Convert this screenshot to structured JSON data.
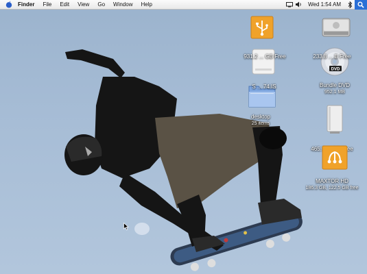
{
  "menubar": {
    "apple_icon": "apple-icon",
    "app_name": "Finder",
    "menus": [
      "File",
      "Edit",
      "View",
      "Go",
      "Window",
      "Help"
    ],
    "clock": "Wed 1:54 AM"
  },
  "desktop": {
    "icons": [
      {
        "label": "",
        "sub": "",
        "icon": "usb-drive-icon"
      },
      {
        "label": "",
        "sub": "",
        "icon": "internal-hard-drive-icon"
      },
      {
        "label": "931.2 ... GB Free",
        "sub": "",
        "icon": "white-drive-icon"
      },
      {
        "label": "233.8 ... B Free",
        "sub": "",
        "icon": "dvd-disc-icon"
      },
      {
        "label": "S ... 74.IS",
        "sub": "",
        "icon": "blue-folder-icon"
      },
      {
        "label": "Bundle DVD",
        "sub": "952.1 MB",
        "icon": "dvd-label-icon"
      },
      {
        "label": "desktop",
        "sub": "25 items",
        "icon": "folder-icon"
      },
      {
        "label": "",
        "sub": "",
        "icon": "external-drive-icon"
      },
      {
        "label": "465.7 ... GB Free",
        "sub": "",
        "icon": "external-drive-label-icon"
      },
      {
        "label": "MAXTOR HD",
        "sub": "186.3 GB, 122.5 GB free",
        "icon": "firewire-drive-icon"
      }
    ]
  },
  "colors": {
    "sky": "#a7bdd6",
    "usb_orange": "#f0a22a",
    "spotlight_blue": "#2a6fd6"
  }
}
